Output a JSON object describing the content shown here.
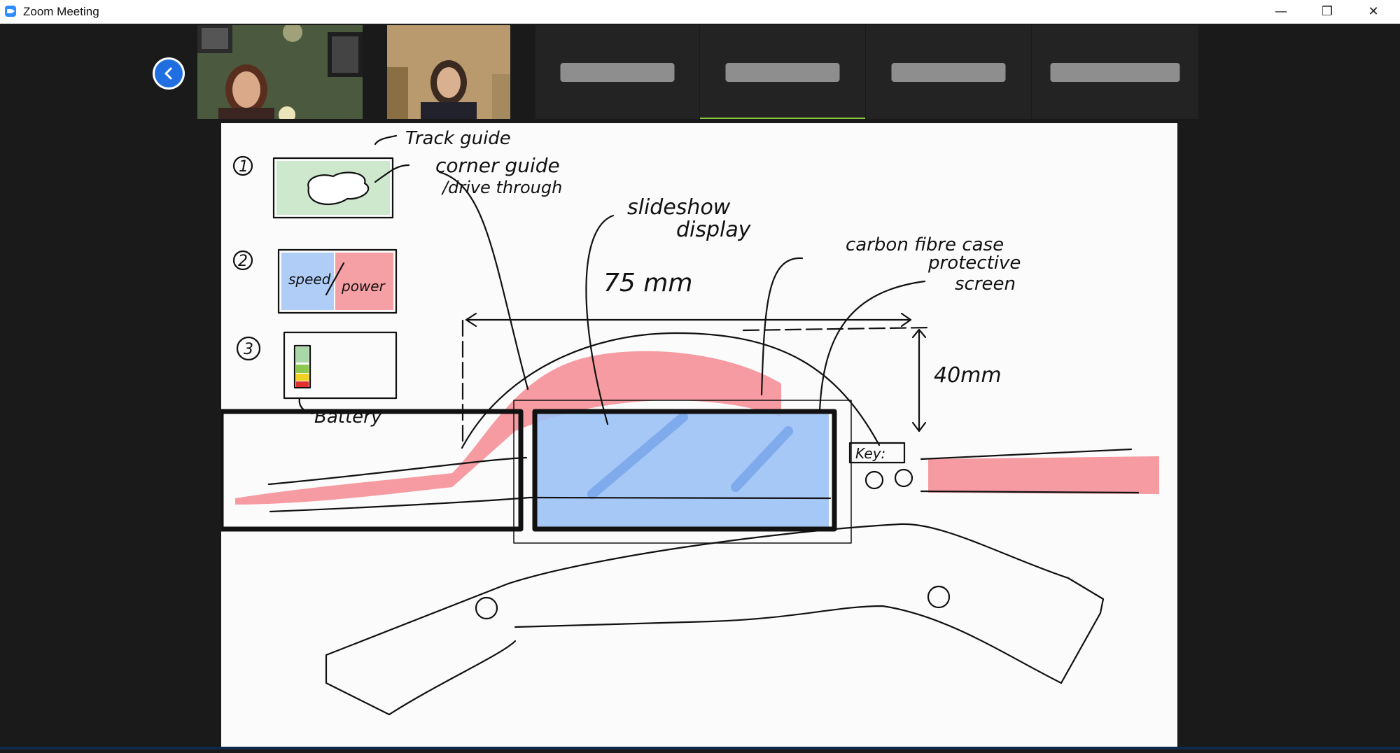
{
  "window": {
    "title": "Zoom Meeting",
    "icon": "zoom-camera-icon",
    "controls": [
      "minimize-icon",
      "restore-icon",
      "close-icon"
    ],
    "minimize_glyph": "—",
    "restore_glyph": "❐",
    "close_glyph": "✕"
  },
  "gallery": {
    "prev_icon": "chevron-left-icon",
    "participants": [
      {
        "type": "video",
        "active": false
      },
      {
        "type": "video",
        "active": false
      },
      {
        "type": "name-hidden",
        "active": false
      },
      {
        "type": "name-hidden",
        "active": true
      },
      {
        "type": "name-hidden",
        "active": false
      },
      {
        "type": "name-hidden",
        "active": false
      }
    ]
  },
  "sketch": {
    "labels": {
      "item1": "1",
      "item2": "2",
      "item3": "3",
      "track_guide": "Track guide",
      "corner_guide": "corner guide",
      "drive_through": "/drive through",
      "speed": "speed",
      "power": "power",
      "battery": "Battery",
      "slideshow": "slideshow",
      "display": "display",
      "carbon_fibre_case": "carbon fibre case",
      "protective": "protective",
      "screen": "screen",
      "width_dim": "75 mm",
      "height_dim": "40mm",
      "key": "Key:"
    },
    "colors": {
      "red": "#f48a90",
      "blue": "#9cc2f5",
      "green": "#a8d8a8",
      "ink": "#111111"
    }
  }
}
